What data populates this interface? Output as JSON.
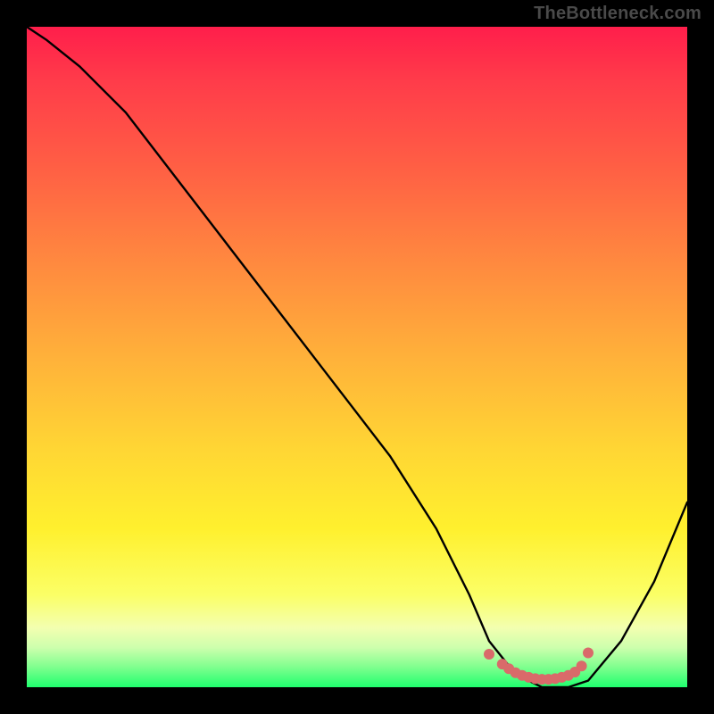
{
  "watermark": "TheBottleneck.com",
  "chart_data": {
    "type": "line",
    "title": "",
    "xlabel": "",
    "ylabel": "",
    "xlim": [
      0,
      100
    ],
    "ylim": [
      0,
      100
    ],
    "series": [
      {
        "name": "curve",
        "x": [
          0,
          3,
          8,
          15,
          25,
          35,
          45,
          55,
          62,
          67,
          70,
          74,
          78,
          82,
          85,
          90,
          95,
          100
        ],
        "y": [
          100,
          98,
          94,
          87,
          74,
          61,
          48,
          35,
          24,
          14,
          7,
          2,
          0,
          0,
          1,
          7,
          16,
          28
        ]
      }
    ],
    "markers": {
      "name": "bottom-cluster",
      "x": [
        70,
        72,
        73,
        74,
        75,
        76,
        77,
        78,
        79,
        80,
        81,
        82,
        83,
        84,
        85
      ],
      "y": [
        5,
        3.5,
        2.8,
        2.2,
        1.8,
        1.5,
        1.3,
        1.2,
        1.2,
        1.3,
        1.5,
        1.8,
        2.3,
        3.2,
        5.2
      ],
      "color": "#d96a6a",
      "size": 6
    },
    "gradient_stops": [
      {
        "pos": 0,
        "color": "#ff1e4b"
      },
      {
        "pos": 8,
        "color": "#ff3b4a"
      },
      {
        "pos": 22,
        "color": "#ff6144"
      },
      {
        "pos": 36,
        "color": "#ff8a3f"
      },
      {
        "pos": 50,
        "color": "#ffb13a"
      },
      {
        "pos": 64,
        "color": "#ffd634"
      },
      {
        "pos": 76,
        "color": "#fff02e"
      },
      {
        "pos": 86,
        "color": "#fbff66"
      },
      {
        "pos": 91,
        "color": "#f3ffb0"
      },
      {
        "pos": 94,
        "color": "#cdffad"
      },
      {
        "pos": 97,
        "color": "#7eff8e"
      },
      {
        "pos": 100,
        "color": "#1fff6e"
      }
    ]
  }
}
